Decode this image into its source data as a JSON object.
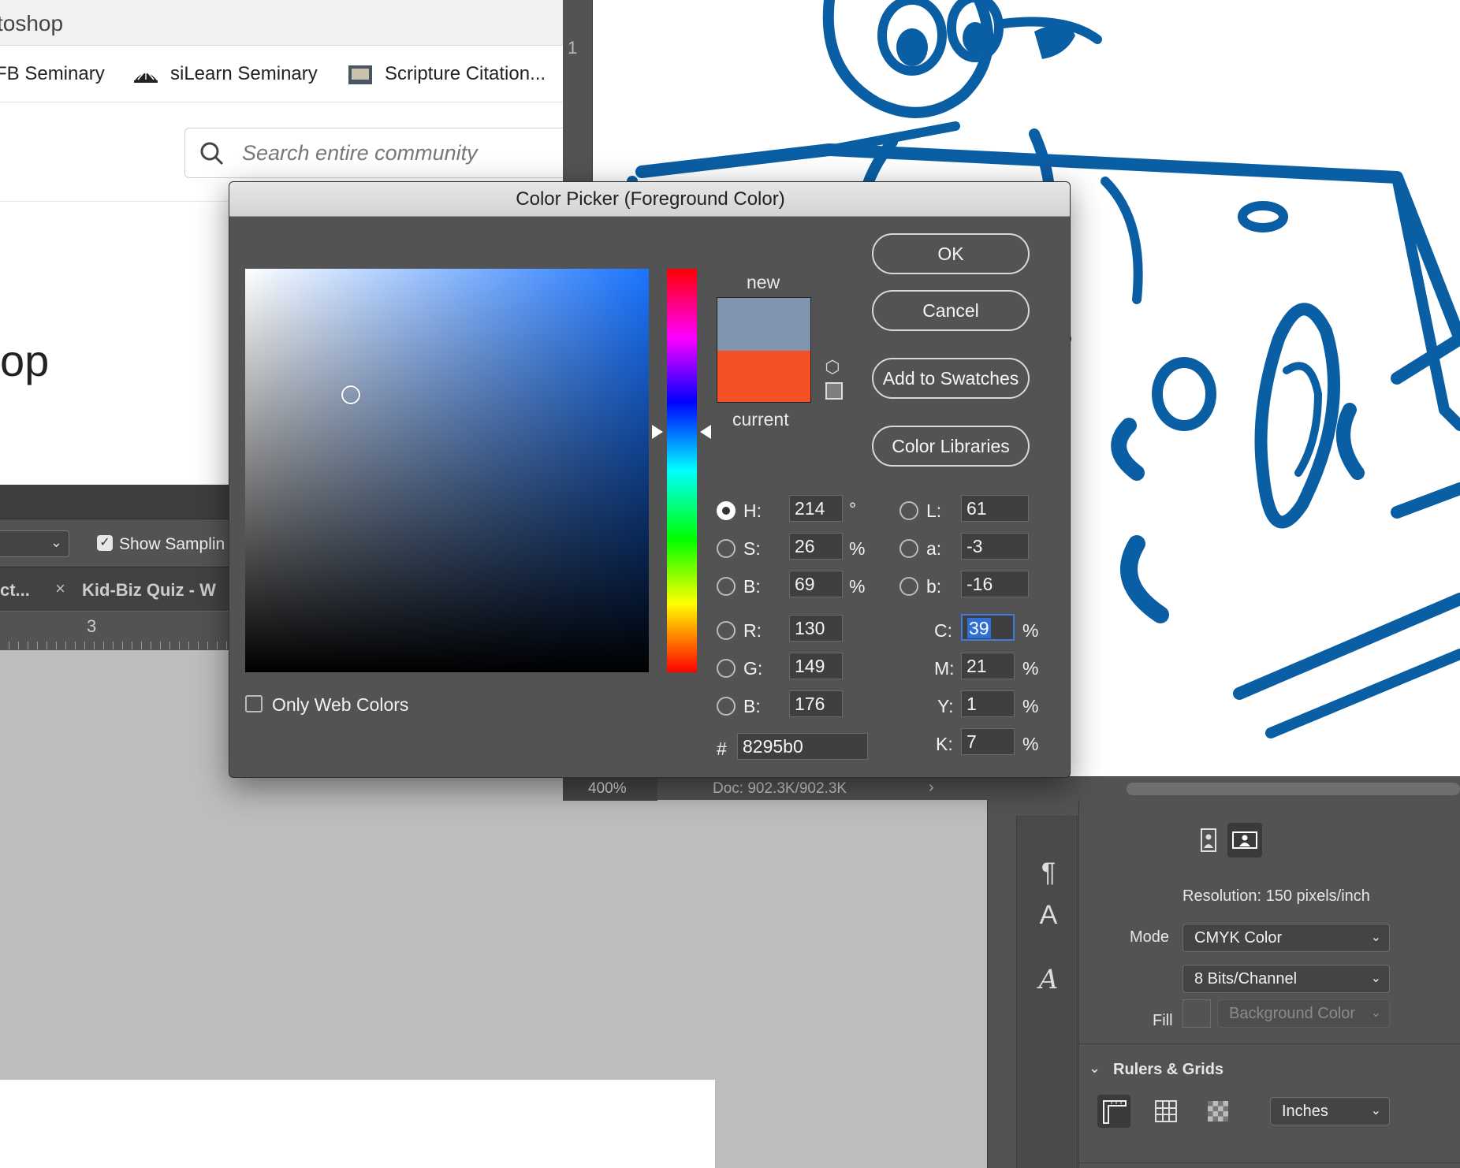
{
  "browser": {
    "title_fragment": "toshop",
    "bookmarks": [
      {
        "label": "FB Seminary"
      },
      {
        "label": "siLearn Seminary"
      },
      {
        "label": "Scripture Citation..."
      }
    ],
    "search_placeholder": "Search entire community",
    "heading_fragment": "op"
  },
  "options_bar": {
    "show_sampling_label": "Show Samplin",
    "tab_fragment": "ct...",
    "tab_close": "×",
    "tab_title": "Kid-Biz Quiz - W",
    "ruler_number": "3",
    "vruler_number": "1"
  },
  "status_bar": {
    "zoom": "400%",
    "doc_info": "Doc: 902.3K/902.3K",
    "arrow": "›"
  },
  "properties": {
    "resolution": "Resolution: 150 pixels/inch",
    "mode_label": "Mode",
    "mode_value": "CMYK Color",
    "bits_value": "8 Bits/Channel",
    "fill_label": "Fill",
    "fill_value": "Background Color",
    "section_title": "Rulers & Grids",
    "units_value": "Inches"
  },
  "color_picker": {
    "title": "Color Picker (Foreground Color)",
    "new_label": "new",
    "current_label": "current",
    "new_color": "#8295b0",
    "current_color": "#f45226",
    "buttons": {
      "ok": "OK",
      "cancel": "Cancel",
      "add_to_swatches": "Add to Swatches",
      "color_libraries": "Color Libraries"
    },
    "hsb": {
      "h_label": "H:",
      "h": "214",
      "h_unit": "°",
      "s_label": "S:",
      "s": "26",
      "s_unit": "%",
      "b_label": "B:",
      "b": "69",
      "b_unit": "%"
    },
    "rgb": {
      "r_label": "R:",
      "r": "130",
      "g_label": "G:",
      "g": "149",
      "b_label": "B:",
      "b": "176"
    },
    "lab": {
      "l_label": "L:",
      "l": "61",
      "a_label": "a:",
      "a": "-3",
      "b_label": "b:",
      "b": "-16"
    },
    "cmyk": {
      "c_label": "C:",
      "c": "39",
      "m_label": "M:",
      "m": "21",
      "y_label": "Y:",
      "y": "1",
      "k_label": "K:",
      "k": "7",
      "unit": "%"
    },
    "hex_label": "#",
    "hex": "8295b0",
    "only_web_colors": "Only Web Colors"
  },
  "colors": {
    "artwork_blue": "#0a5ea3",
    "ps_panel": "#535353",
    "accent_blue": "#3d7ce0"
  },
  "icons": [
    "search-icon",
    "bookmark-icon",
    "scripture-icon",
    "chevron-down-icon",
    "checkbox-icon",
    "close-icon",
    "cube-icon",
    "web-safe-icon",
    "paragraph-icon",
    "character-icon",
    "glyphs-icon",
    "portrait-icon",
    "landscape-icon",
    "ruler-icon",
    "grid-icon",
    "transparency-grid-icon"
  ]
}
